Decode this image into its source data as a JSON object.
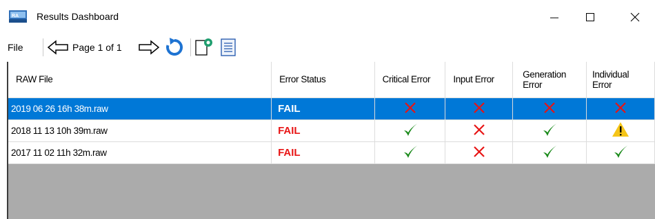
{
  "window": {
    "title": "Results Dashboard",
    "icon_text": "RA"
  },
  "toolbar": {
    "file_label": "File",
    "page_label": "Page 1 of 1"
  },
  "table": {
    "columns": [
      "RAW File",
      "Error Status",
      "Critical Error",
      "Input Error",
      "Generation Error",
      "Individual Error"
    ],
    "rows": [
      {
        "file": "2019 06 26 16h 38m.raw",
        "status": "FAIL",
        "critical": "cross",
        "input": "cross",
        "generation": "cross",
        "individual": "cross",
        "selected": true
      },
      {
        "file": "2018 11 13 10h 39m.raw",
        "status": "FAIL",
        "critical": "check",
        "input": "cross",
        "generation": "check",
        "individual": "warning",
        "selected": false
      },
      {
        "file": "2017 11 02 11h 32m.raw",
        "status": "FAIL",
        "critical": "check",
        "input": "cross",
        "generation": "check",
        "individual": "check",
        "selected": false
      }
    ]
  },
  "colors": {
    "selection": "#0078d7",
    "fail_red": "#e81414",
    "check_green": "#1a8a1a",
    "cross_red": "#e81414",
    "refresh_blue": "#1e73d2"
  }
}
